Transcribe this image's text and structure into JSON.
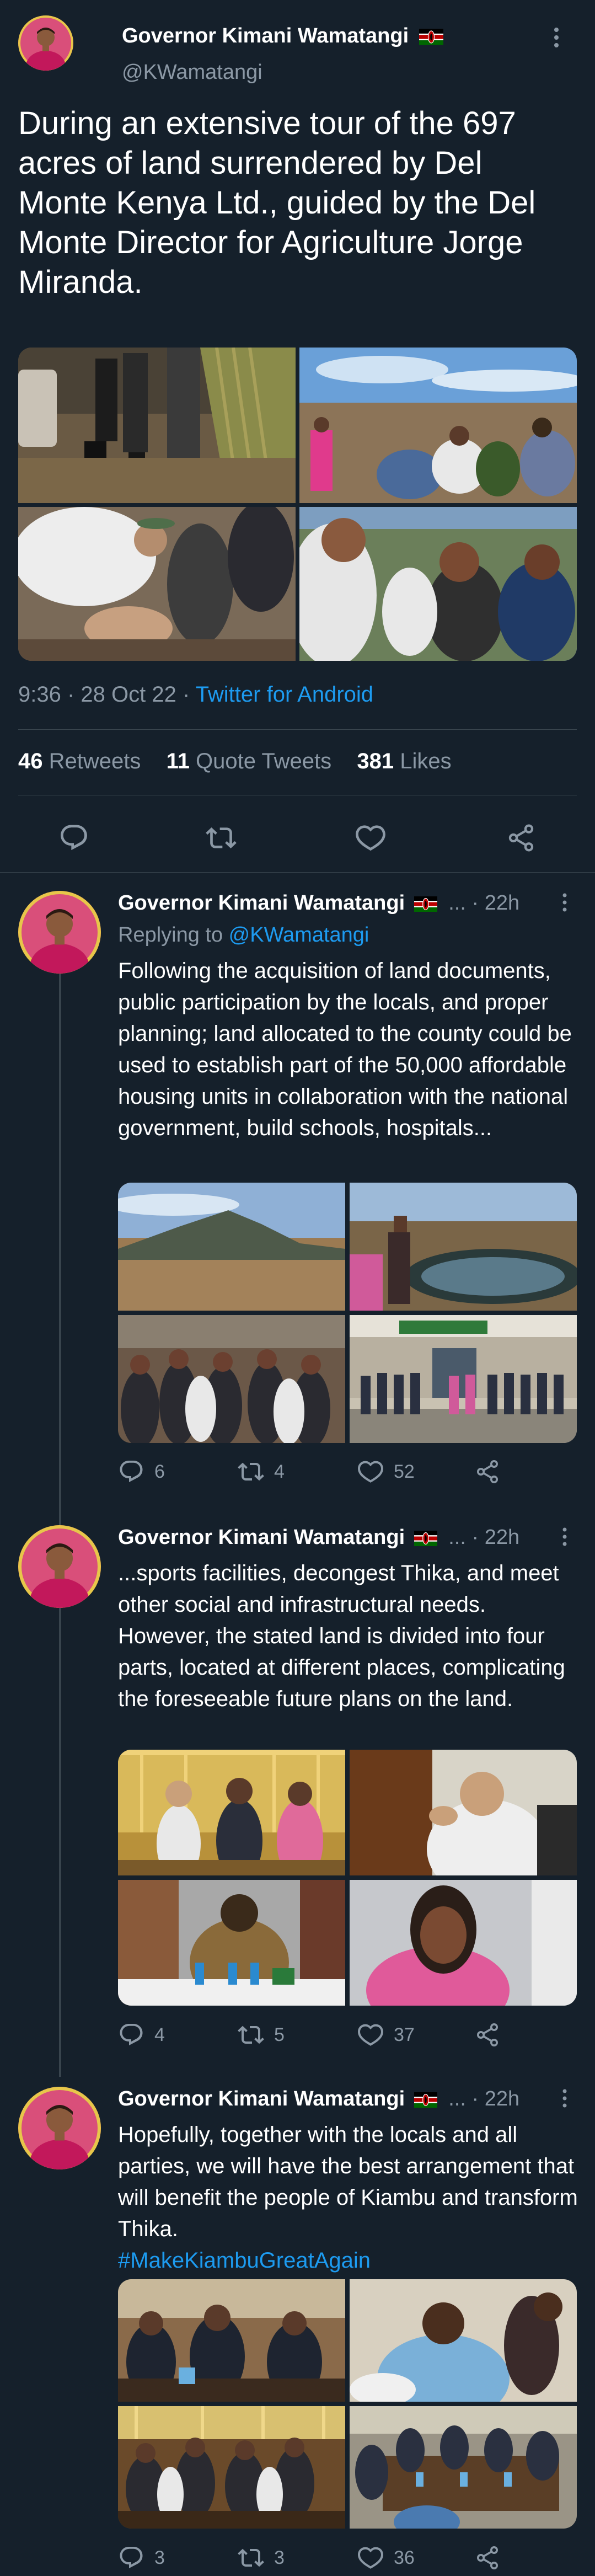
{
  "main_tweet": {
    "author_name": "Governor Kimani Wamatangi",
    "author_handle": "@KWamatangi",
    "text": "During an extensive tour of the 697 acres of land surrendered by Del Monte Kenya Ltd., guided by the Del Monte Director for Agriculture Jorge Miranda.",
    "time": "9:36 · 28 Oct 22 · ",
    "source": "Twitter for Android",
    "retweets_count": "46",
    "retweets_label": " Retweets",
    "quotes_count": "11",
    "quotes_label": " Quote Tweets",
    "likes_count": "381",
    "likes_label": " Likes"
  },
  "replies": [
    {
      "author_name": "Governor Kimani Wamatangi",
      "meta": "... · 22h",
      "replying_prefix": "Replying to ",
      "replying_handle": "@KWamatangi",
      "text": "Following the acquisition of land documents, public participation by the locals, and proper planning; land allocated to the county could be used to establish part of the 50,000 affordable housing units in collaboration with the national government, build schools, hospitals...",
      "reply_count": "6",
      "retweet_count": "4",
      "like_count": "52"
    },
    {
      "author_name": "Governor Kimani Wamatangi",
      "meta": "... · 22h",
      "text": "...sports facilities, decongest Thika, and meet other social and infrastructural needs. However, the stated land is divided into four parts, located at different places, complicating the foreseeable future plans on the land.",
      "reply_count": "4",
      "retweet_count": "5",
      "like_count": "37"
    },
    {
      "author_name": "Governor Kimani Wamatangi",
      "meta": "... · 22h",
      "text": "Hopefully, together with the locals and all parties, we will have the best arrangement that will benefit the people of Kiambu and transform Thika.",
      "hashtag": "#MakeKiambuGreatAgain",
      "reply_count": "3",
      "retweet_count": "3",
      "like_count": "36"
    }
  ],
  "colors": {
    "background": "#15202b",
    "text": "#ffffff",
    "muted": "#8b98a5",
    "accent": "#1d9bf0",
    "divider": "#38444d"
  },
  "icons": [
    "more-icon",
    "kenya-flag-icon",
    "reply-icon",
    "retweet-icon",
    "like-icon",
    "share-icon"
  ]
}
